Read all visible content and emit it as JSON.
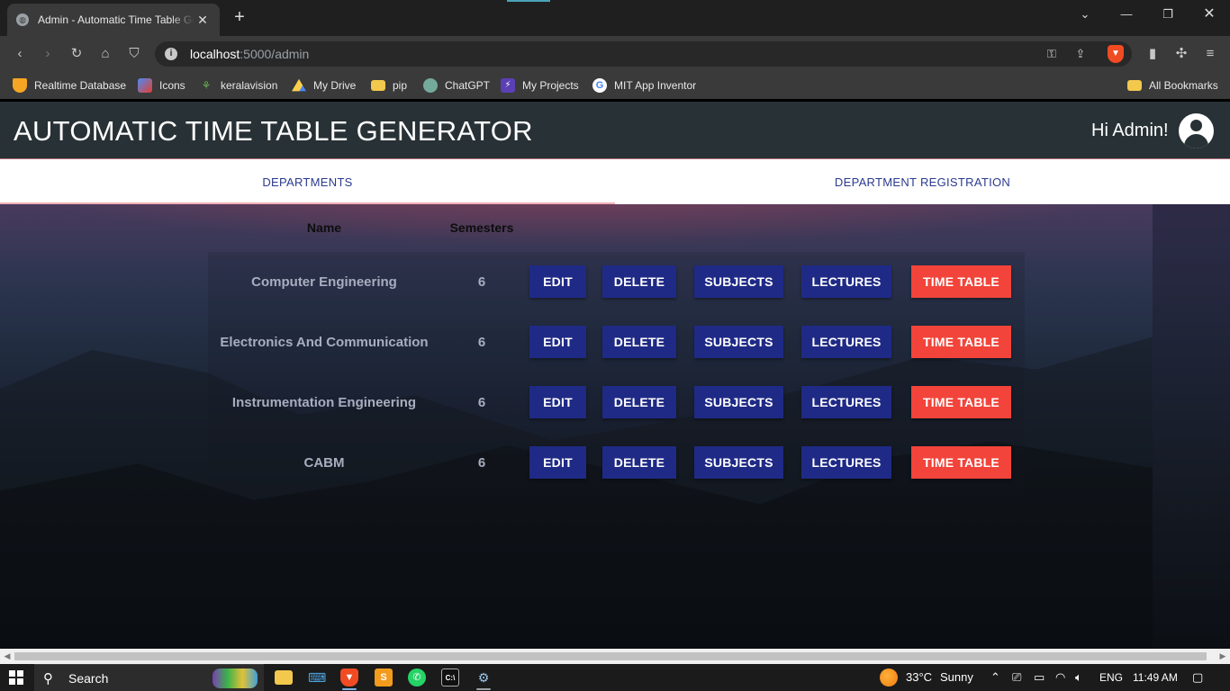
{
  "browser": {
    "tab_title": "Admin - Automatic Time Table Generator",
    "url_host": "localhost",
    "url_path": ":5000/admin",
    "new_tab_label": "+",
    "bookmarks": [
      {
        "label": "Realtime Database",
        "icon": "firebase-icon",
        "color": "#f5a623"
      },
      {
        "label": "Icons",
        "icon": "icons-icon",
        "color": "#4a8af4"
      },
      {
        "label": "keralavision",
        "icon": "keralavision-icon",
        "color": "#5a9f3a"
      },
      {
        "label": "My Drive",
        "icon": "google-drive-icon",
        "color": "#1fa463"
      },
      {
        "label": "pip",
        "icon": "folder-icon",
        "color": "#f2c94c"
      },
      {
        "label": "ChatGPT",
        "icon": "chatgpt-icon",
        "color": "#9aa0a6"
      },
      {
        "label": "My Projects",
        "icon": "projects-icon",
        "color": "#7a3fd8"
      },
      {
        "label": "MIT App Inventor",
        "icon": "google-icon",
        "color": "#ffffff"
      }
    ],
    "all_bookmarks": "All Bookmarks"
  },
  "app": {
    "title": "AUTOMATIC TIME TABLE GENERATOR",
    "greeting": "Hi Admin!",
    "tabs": [
      {
        "label": "DEPARTMENTS",
        "active": true
      },
      {
        "label": "DEPARTMENT REGISTRATION",
        "active": false
      }
    ],
    "columns": {
      "name": "Name",
      "semesters": "Semesters"
    },
    "buttons": {
      "edit": "EDIT",
      "delete": "DELETE",
      "subjects": "SUBJECTS",
      "lectures": "LECTURES",
      "timetable": "TIME TABLE"
    },
    "departments": [
      {
        "name": "Computer Engineering",
        "semesters": "6"
      },
      {
        "name": "Electronics And Communication",
        "semesters": "6"
      },
      {
        "name": "Instrumentation Engineering",
        "semesters": "6"
      },
      {
        "name": "CABM",
        "semesters": "6"
      }
    ],
    "colors": {
      "header_bg": "#283135",
      "primary_button": "#1f2a86",
      "timetable_button": "#f2443a",
      "tab_text": "#2b3a8f"
    }
  },
  "taskbar": {
    "search_placeholder": "Search",
    "weather_temp": "33°C",
    "weather_text": "Sunny",
    "language": "ENG",
    "time": "11:49 AM"
  }
}
